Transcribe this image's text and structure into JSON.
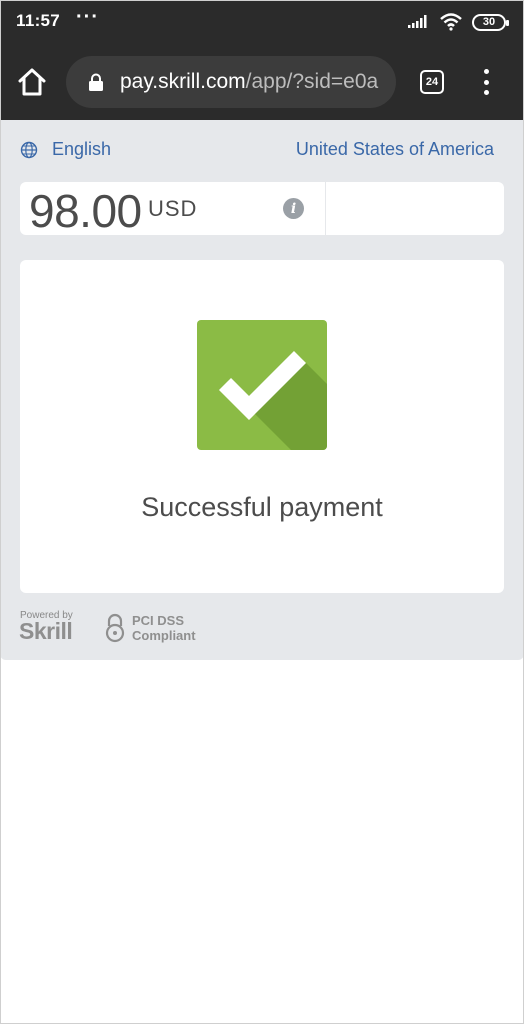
{
  "status_bar": {
    "time": "11:57",
    "dots": "···",
    "battery": "30"
  },
  "browser": {
    "url_host": "pay.skrill.com",
    "url_path": "/app/?sid=e0a",
    "tab_count": "24"
  },
  "page": {
    "language": "English",
    "country": "United States of America",
    "amount": "98.00",
    "currency": "USD",
    "info_label": "i",
    "success_text": "Successful payment",
    "footer": {
      "powered_by": "Powered by",
      "brand": "Skrill",
      "pci_line1": "PCI DSS",
      "pci_line2": "Compliant"
    }
  },
  "colors": {
    "accent_link": "#3a68a8",
    "success_green": "#8bbb45",
    "chrome_dark": "#2b2b2b"
  }
}
